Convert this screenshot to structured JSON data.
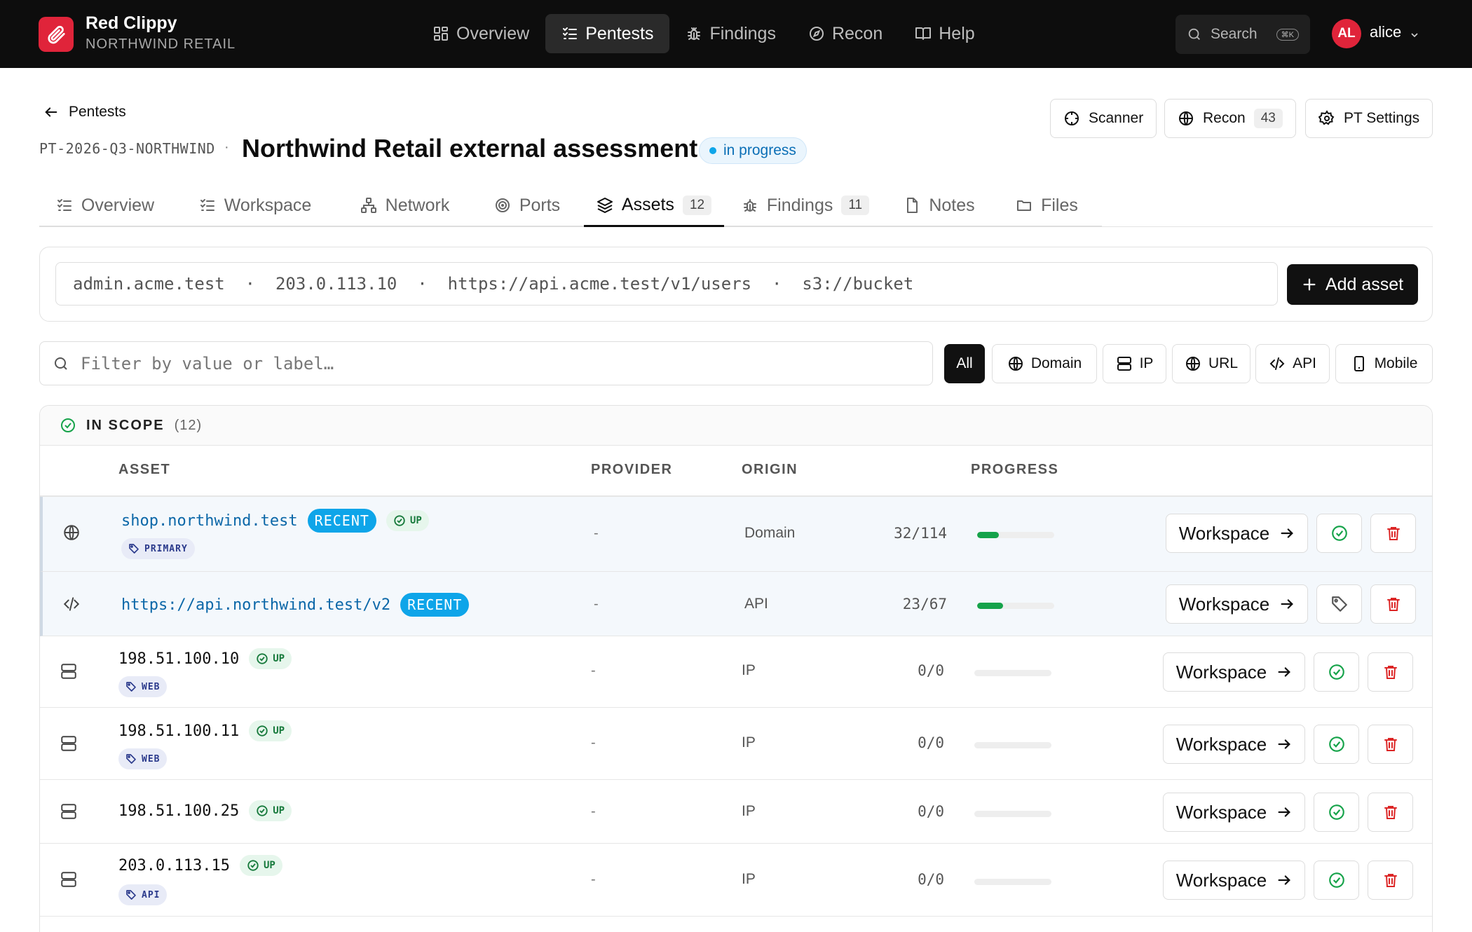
{
  "brand": {
    "name": "Red Clippy",
    "org": "NORTHWIND RETAIL"
  },
  "topnav": [
    {
      "label": "Overview",
      "icon": "grid-icon"
    },
    {
      "label": "Pentests",
      "icon": "checklist-icon",
      "active": true
    },
    {
      "label": "Findings",
      "icon": "bug-icon"
    },
    {
      "label": "Recon",
      "icon": "compass-icon"
    },
    {
      "label": "Help",
      "icon": "book-icon"
    }
  ],
  "search": {
    "label": "Search",
    "shortcut": "⌘K"
  },
  "user": {
    "initials": "AL",
    "name": "alice"
  },
  "header": {
    "back_label": "Pentests",
    "pentest_id": "PT-2026-Q3-NORTHWIND",
    "separator": "·",
    "title": "Northwind Retail external assessment",
    "status": "in progress",
    "buttons": {
      "scanner": "Scanner",
      "recon": "Recon",
      "recon_count": "43",
      "settings": "PT Settings"
    }
  },
  "tabs": [
    {
      "label": "Overview"
    },
    {
      "label": "Workspace"
    },
    {
      "label": "Network"
    },
    {
      "label": "Ports"
    },
    {
      "label": "Assets",
      "count": "12",
      "active": true
    },
    {
      "label": "Findings",
      "count": "11"
    },
    {
      "label": "Notes"
    },
    {
      "label": "Files"
    }
  ],
  "add_asset": {
    "placeholder": "admin.acme.test  ·  203.0.113.10  ·  https://api.acme.test/v1/users  ·  s3://bucket",
    "button": "Add asset"
  },
  "filter": {
    "placeholder": "Filter by value or label…",
    "chips": [
      "All",
      "Domain",
      "IP",
      "URL",
      "API",
      "Mobile"
    ],
    "active_chip": "All"
  },
  "scope": {
    "title": "IN SCOPE",
    "count": "(12)"
  },
  "columns": {
    "asset": "ASSET",
    "provider": "PROVIDER",
    "origin": "ORIGIN",
    "progress": "PROGRESS"
  },
  "rows": [
    {
      "icon": "globe-icon",
      "value": "shop.northwind.test",
      "recent": "RECENT",
      "up": "UP",
      "tag": "PRIMARY",
      "provider": "-",
      "origin": "Domain",
      "progress": "32/114",
      "fill": 0.28,
      "action": "Workspace",
      "status_action": "check-circle-icon",
      "highlight": true
    },
    {
      "icon": "code-icon",
      "value": "https://api.northwind.test/v2",
      "recent": "RECENT",
      "up": null,
      "tag": null,
      "provider": "-",
      "origin": "API",
      "progress": "23/67",
      "fill": 0.34,
      "action": "Workspace",
      "status_action": "tag-icon",
      "highlight": true
    },
    {
      "icon": "server-icon",
      "value": "198.51.100.10",
      "recent": null,
      "up": "UP",
      "tag": "WEB",
      "provider": "-",
      "origin": "IP",
      "progress": "0/0",
      "fill": 0,
      "action": "Workspace",
      "status_action": "check-circle-icon"
    },
    {
      "icon": "server-icon",
      "value": "198.51.100.11",
      "recent": null,
      "up": "UP",
      "tag": "WEB",
      "provider": "-",
      "origin": "IP",
      "progress": "0/0",
      "fill": 0,
      "action": "Workspace",
      "status_action": "check-circle-icon"
    },
    {
      "icon": "server-icon",
      "value": "198.51.100.25",
      "recent": null,
      "up": "UP",
      "tag": null,
      "provider": "-",
      "origin": "IP",
      "progress": "0/0",
      "fill": 0,
      "action": "Workspace",
      "status_action": "check-circle-icon"
    },
    {
      "icon": "server-icon",
      "value": "203.0.113.15",
      "recent": null,
      "up": "UP",
      "tag": "API",
      "provider": "-",
      "origin": "IP",
      "progress": "0/0",
      "fill": 0,
      "action": "Workspace",
      "status_action": "check-circle-icon"
    }
  ],
  "colors": {
    "brand": "#e0243a",
    "dark": "#0d0d0d",
    "accent": "#0ea5e9",
    "success": "#16a34a",
    "danger": "#dc2626"
  }
}
